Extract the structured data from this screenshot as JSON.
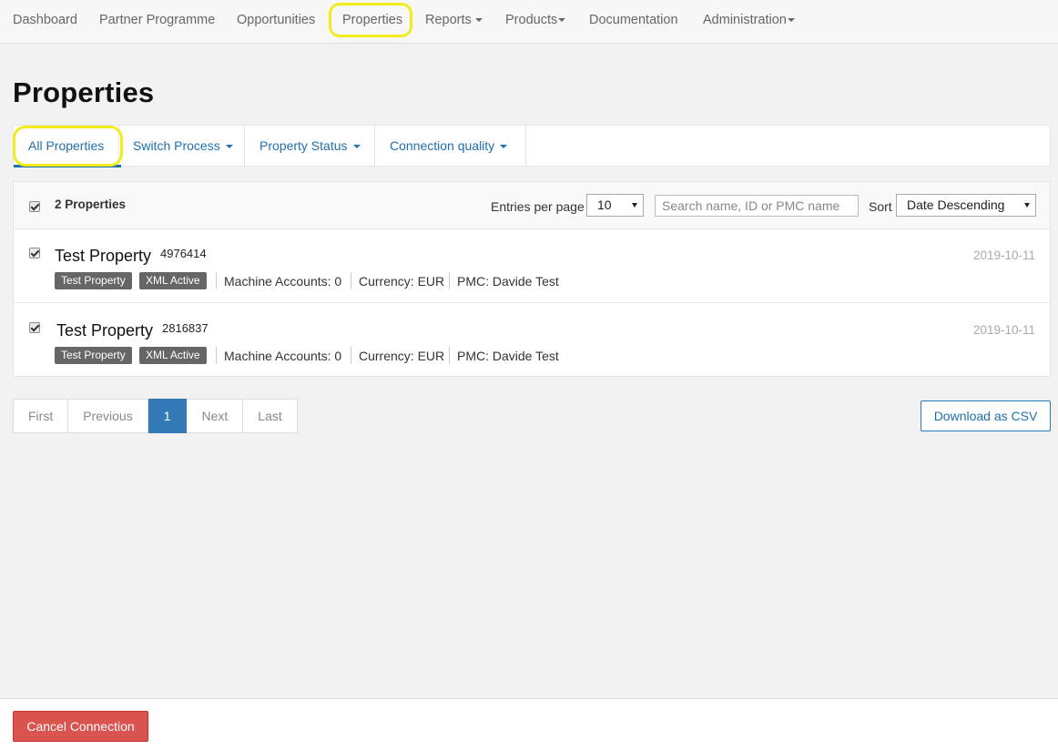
{
  "nav": {
    "items": [
      {
        "label": "Dashboard"
      },
      {
        "label": "Partner Programme"
      },
      {
        "label": "Opportunities"
      },
      {
        "label": "Properties"
      },
      {
        "label": "Reports"
      },
      {
        "label": "Products"
      },
      {
        "label": "Documentation"
      },
      {
        "label": "Administration"
      }
    ]
  },
  "page": {
    "title": "Properties"
  },
  "tabs": [
    {
      "label": "All Properties",
      "active": true
    },
    {
      "label": "Switch Process"
    },
    {
      "label": "Property Status"
    },
    {
      "label": "Connection quality"
    }
  ],
  "list": {
    "count_label": "2 Properties",
    "entries_label": "Entries per page",
    "entries_value": "10",
    "search_placeholder": "Search name, ID or PMC name",
    "sort_label": "Sort",
    "sort_value": "Date Descending",
    "rows": [
      {
        "name": "Test Property",
        "id": "4976414",
        "date": "2019-10-11",
        "badge1": "Test Property",
        "badge2": "XML Active",
        "machine_accounts": "Machine Accounts: 0",
        "currency": "Currency: EUR",
        "pmc": "PMC: Davide Test"
      },
      {
        "name": "Test Property",
        "id": "2816837",
        "date": "2019-10-11",
        "badge1": "Test Property",
        "badge2": "XML Active",
        "machine_accounts": "Machine Accounts: 0",
        "currency": "Currency: EUR",
        "pmc": "PMC: Davide Test"
      }
    ]
  },
  "pagination": {
    "first": "First",
    "previous": "Previous",
    "current": "1",
    "next": "Next",
    "last": "Last"
  },
  "actions": {
    "download_csv": "Download as CSV",
    "cancel_connection": "Cancel Connection"
  },
  "colors": {
    "link": "#1f6fae",
    "active_page": "#337ab7",
    "danger": "#d9534f",
    "badge": "#666666",
    "highlight": "#f2ec1d"
  }
}
